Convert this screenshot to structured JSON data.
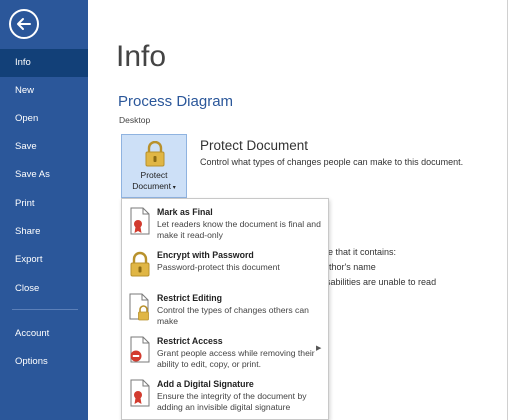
{
  "sidebar": {
    "items": [
      {
        "label": "Info"
      },
      {
        "label": "New"
      },
      {
        "label": "Open"
      },
      {
        "label": "Save"
      },
      {
        "label": "Save As"
      },
      {
        "label": "Print"
      },
      {
        "label": "Share"
      },
      {
        "label": "Export"
      },
      {
        "label": "Close"
      },
      {
        "label": "Account"
      },
      {
        "label": "Options"
      }
    ]
  },
  "main": {
    "title": "Info",
    "doc_title": "Process Diagram",
    "doc_location": "Desktop",
    "protect": {
      "button_label_line1": "Protect",
      "button_label_line2": "Document",
      "heading": "Protect Document",
      "description": "Control what types of changes people can make to this document."
    },
    "behind": {
      "line1": "are that it contains:",
      "line2": "uthor's name",
      "line3": "isabilities are unable to read"
    }
  },
  "protect_menu": {
    "items": [
      {
        "title": "Mark as Final",
        "description": "Let readers know the document is final and make it read-only",
        "icon": "mark-final-icon"
      },
      {
        "title": "Encrypt with Password",
        "description": "Password-protect this document",
        "icon": "padlock-icon"
      },
      {
        "title": "Restrict Editing",
        "description": "Control the types of changes others can make",
        "icon": "restrict-editing-icon"
      },
      {
        "title": "Restrict Access",
        "description": "Grant people access while removing their ability to edit, copy, or print.",
        "icon": "restrict-access-icon"
      },
      {
        "title": "Add a Digital Signature",
        "description": "Ensure the integrity of the document by adding an invisible digital signature",
        "icon": "digital-signature-icon"
      }
    ]
  },
  "colors": {
    "sidebar_bg": "#2b579a",
    "sidebar_active": "#124078",
    "accent_text": "#2b579a",
    "protect_button_bg": "#cde0f7"
  }
}
